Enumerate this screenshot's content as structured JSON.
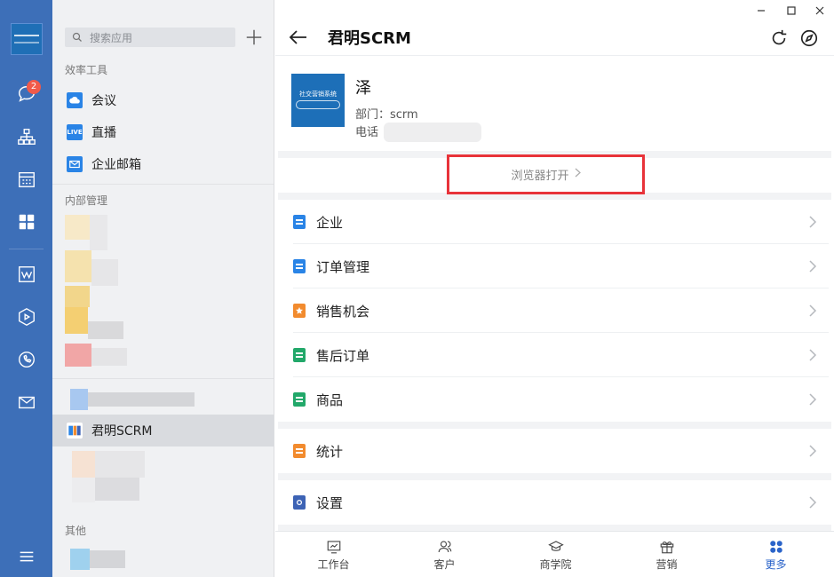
{
  "sidebar": {
    "search_placeholder": "搜索应用",
    "sections": {
      "efficiency": "效率工具",
      "internal": "内部管理",
      "other": "其他"
    },
    "items": {
      "meeting": "会议",
      "live": "直播",
      "live_icon_text": "LIVE",
      "email": "企业邮箱",
      "scrm": "君明SCRM"
    }
  },
  "rail": {
    "badge": "2"
  },
  "main": {
    "title": "君明SCRM",
    "card": {
      "name": "泽",
      "dept": "部门：scrm",
      "phone_label": "电话",
      "logo_text": "社交营销系统"
    },
    "browser_open": "浏览器打开",
    "menu": [
      {
        "label": "企业",
        "color": "#2a84e6"
      },
      {
        "label": "订单管理",
        "color": "#2a84e6"
      },
      {
        "label": "销售机会",
        "color": "#f28b2e"
      },
      {
        "label": "售后订单",
        "color": "#22a86a"
      },
      {
        "label": "商品",
        "color": "#22a86a"
      },
      {
        "label": "统计",
        "color": "#f28b2e"
      },
      {
        "label": "设置",
        "color": "#3d63b5"
      }
    ],
    "tabs": [
      "工作台",
      "客户",
      "商学院",
      "营销",
      "更多"
    ]
  },
  "colors": {
    "accent": "#2a63c9",
    "rail": "#3d6fb8",
    "highlight": "#e8333a"
  }
}
